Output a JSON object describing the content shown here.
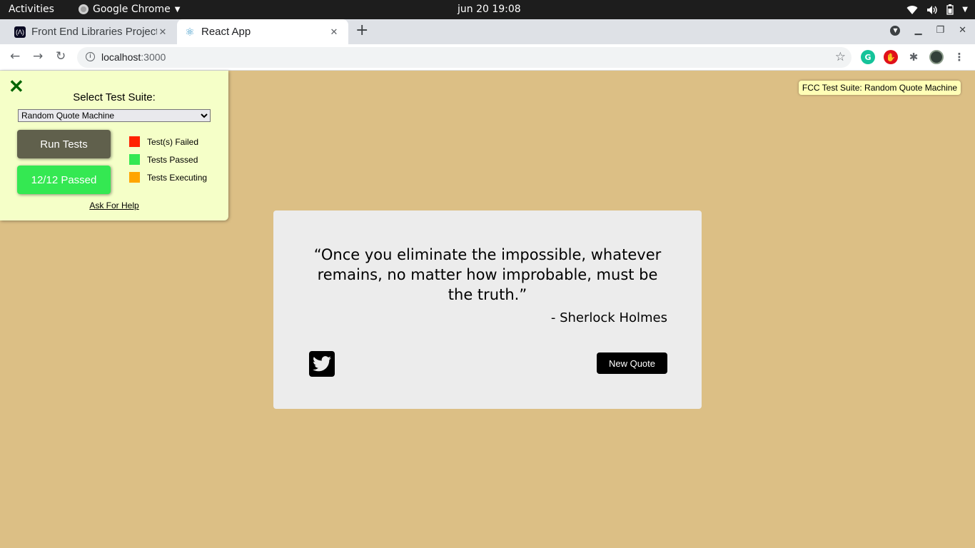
{
  "system_bar": {
    "activities": "Activities",
    "app_name": "Google Chrome",
    "clock": "jun 20  19:08"
  },
  "browser": {
    "tabs": [
      {
        "title": "Front End Libraries Projects",
        "active": false,
        "favicon": "fcc-icon"
      },
      {
        "title": "React App",
        "active": true,
        "favicon": "react-icon"
      }
    ],
    "url_host": "localhost",
    "url_port": ":3000",
    "extensions": [
      "grammarly-icon",
      "ublock-icon",
      "puzzle-icon",
      "profile-avatar"
    ]
  },
  "fcc": {
    "select_label": "Select Test Suite:",
    "selected_suite": "Random Quote Machine",
    "run_label": "Run Tests",
    "passed_label": "12/12 Passed",
    "legend": [
      {
        "label": "Test(s) Failed",
        "color": "#ff2200"
      },
      {
        "label": "Tests Passed",
        "color": "#34e852"
      },
      {
        "label": "Tests Executing",
        "color": "#ffa500"
      }
    ],
    "help_label": "Ask For Help",
    "badge": "FCC Test Suite: Random Quote Machine"
  },
  "quote": {
    "text": "“Once you eliminate the impossible, whatever remains, no matter how improbable, must be the truth.”",
    "author": "- Sherlock Holmes",
    "new_quote_label": "New Quote"
  },
  "colors": {
    "page_background": "#dcbf85",
    "quote_box": "#ececec",
    "fcc_panel": "#f5ffc8"
  }
}
